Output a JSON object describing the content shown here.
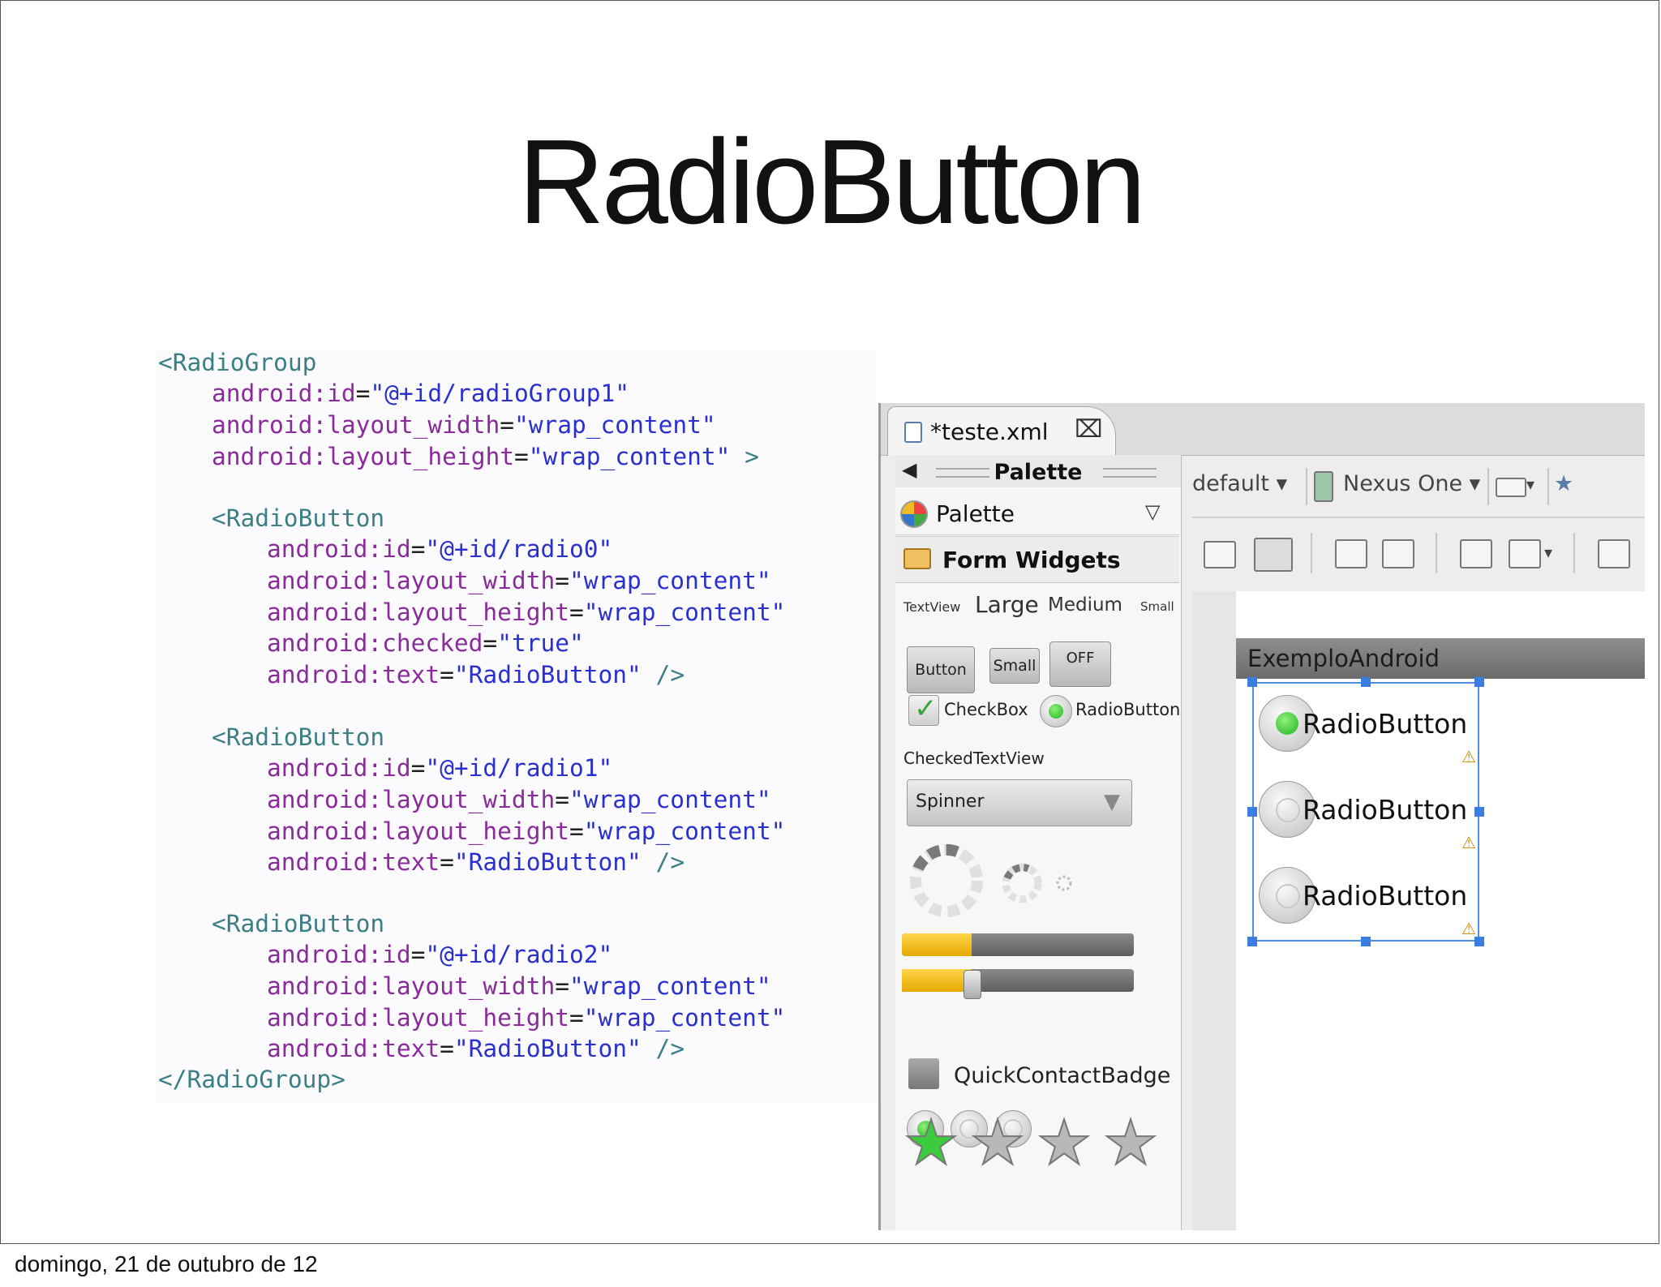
{
  "slide": {
    "title": "RadioButton",
    "footer": "domingo, 21 de outubro de 12"
  },
  "code": {
    "l1": "<RadioGroup",
    "l2_attr": "android:id",
    "l2_val": "\"@+id/radioGroup1\"",
    "l3_attr": "android:layout_width",
    "l3_val": "\"wrap_content\"",
    "l4_attr": "android:layout_height",
    "l4_val": "\"wrap_content\"",
    "l4_end": " >",
    "rb_open": "<RadioButton",
    "id_attr": "android:id",
    "r0_id": "\"@+id/radio0\"",
    "r1_id": "\"@+id/radio1\"",
    "r2_id": "\"@+id/radio2\"",
    "width_attr": "android:layout_width",
    "height_attr": "android:layout_height",
    "wrap": "\"wrap_content\"",
    "checked_attr": "android:checked",
    "checked_val": "\"true\"",
    "text_attr": "android:text",
    "text_val": "\"RadioButton\"",
    "self_close": " />",
    "eq": "=",
    "close_group": "</RadioGroup>"
  },
  "ide": {
    "tab_label": "*teste.xml",
    "tab_close": "⌧",
    "palette_header": "Palette",
    "palette_select": "Palette",
    "category": "Form Widgets",
    "tv_textview": "TextView",
    "tv_large": "Large",
    "tv_medium": "Medium",
    "tv_small": "Small",
    "btn_button": "Button",
    "btn_small": "Small",
    "btn_off": "OFF",
    "checkbox": "CheckBox",
    "radiobutton": "RadioButton",
    "checkedtextview": "CheckedTextView",
    "spinner": "Spinner",
    "quickcontactbadge": "QuickContactBadge",
    "progress_fraction": 0.3,
    "seek_fraction": 0.3,
    "rating_value": 1,
    "rating_max": 4,
    "toolbar_default": "default",
    "toolbar_device": "Nexus One",
    "app_title": "ExemploAndroid",
    "radios": [
      {
        "label": "RadioButton",
        "checked": true
      },
      {
        "label": "RadioButton",
        "checked": false
      },
      {
        "label": "RadioButton",
        "checked": false
      }
    ],
    "warning_glyph": "⚠",
    "colors": {
      "accent_green": "#1fb51f",
      "selection_blue": "#4f8ee6",
      "progress_yellow": "#e6a800"
    }
  }
}
